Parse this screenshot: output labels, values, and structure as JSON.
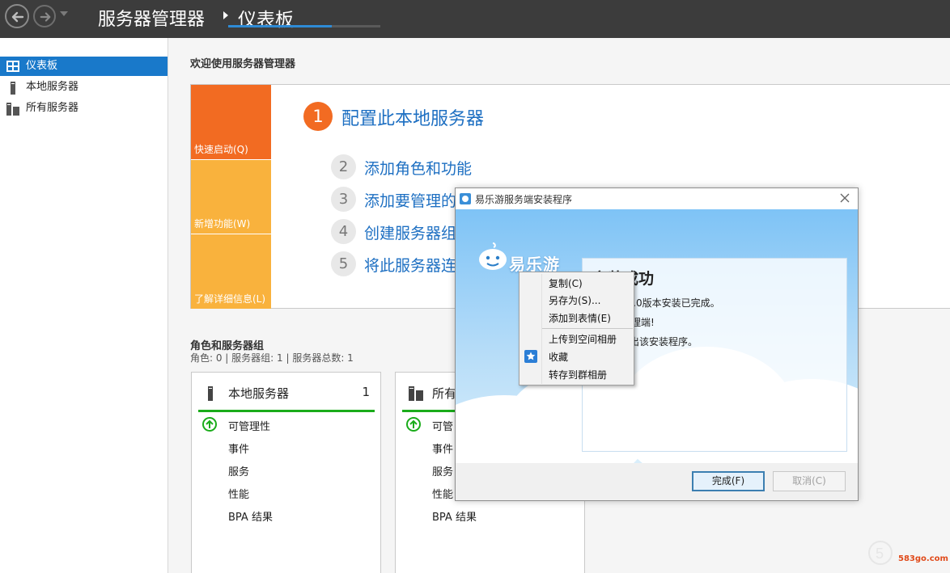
{
  "titlebar": {
    "app_title": "服务器管理器",
    "breadcrumb": "仪表板",
    "progress_percent": 68
  },
  "sidebar": {
    "items": [
      {
        "label": "仪表板",
        "icon": "dashboard-icon",
        "active": true
      },
      {
        "label": "本地服务器",
        "icon": "server-icon",
        "active": false
      },
      {
        "label": "所有服务器",
        "icon": "servers-icon",
        "active": false
      }
    ]
  },
  "main": {
    "welcome": "欢迎使用服务器管理器",
    "tiles": [
      "快速启动(Q)",
      "新增功能(W)",
      "了解详细信息(L)"
    ],
    "steps": [
      {
        "num": "1",
        "label": "配置此本地服务器"
      },
      {
        "num": "2",
        "label": "添加角色和功能"
      },
      {
        "num": "3",
        "label": "添加要管理的"
      },
      {
        "num": "4",
        "label": "创建服务器组"
      },
      {
        "num": "5",
        "label": "将此服务器连"
      }
    ],
    "roles_title": "角色和服务器组",
    "roles_sub": "角色: 0 | 服务器组: 1 | 服务器总数: 1",
    "cards": [
      {
        "title": "本地服务器",
        "count": "1",
        "rows": [
          "可管理性",
          "事件",
          "服务",
          "性能",
          "BPA 结果"
        ]
      },
      {
        "title": "所有",
        "count": "",
        "rows": [
          "可管",
          "事件",
          "服务",
          "性能",
          "BPA 结果"
        ]
      }
    ]
  },
  "dialog": {
    "title": "易乐游服务端安装程序",
    "logo_text": "易乐游",
    "head": "安装成功",
    "lines": [
      "端2.2.11.0版本安装已完成。",
      "易乐游管理端!",
      "完成” 退出该安装程序。"
    ],
    "finish_label": "完成(F)",
    "cancel_label": "取消(C)"
  },
  "context_menu": {
    "items": [
      "复制(C)",
      "另存为(S)...",
      "添加到表情(E)",
      "上传到空间相册",
      "收藏",
      "转存到群相册"
    ]
  },
  "watermark": {
    "text": "583go.com"
  },
  "colors": {
    "accent_blue": "#1979ca",
    "tile_orange": "#f26b22",
    "tile_yellow": "#f9b23d",
    "link_blue": "#1d6fc2",
    "status_green": "#1aac1a"
  }
}
